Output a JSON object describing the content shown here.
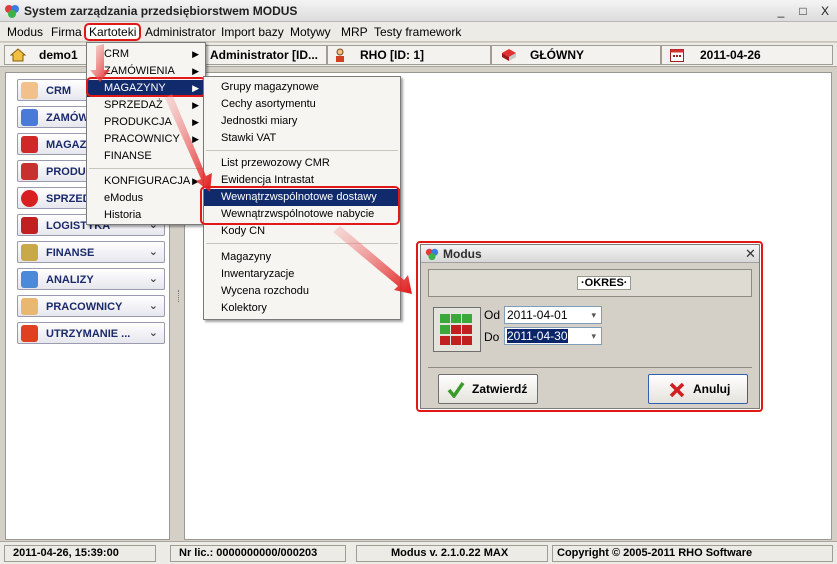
{
  "window": {
    "title": "System zarządzania przedsiębiorstwem MODUS",
    "buttons": [
      "_",
      "□",
      "X"
    ]
  },
  "menubar": [
    "Modus",
    "Firma",
    "Kartoteki",
    "Administrator",
    "Import bazy",
    "Motywy",
    "MRP",
    "Testy framework"
  ],
  "toolbar": {
    "company": "demo1",
    "user": "Administrator [ID...",
    "rho": "RHO [ID: 1]",
    "warehouse": "GŁÓWNY",
    "date": "2011-04-26"
  },
  "sidebar": [
    {
      "label": "CRM",
      "icon": "person-icon"
    },
    {
      "label": "ZAMÓWIENIA",
      "icon": "order-icon"
    },
    {
      "label": "MAGAZYNY",
      "icon": "warehouse-icon"
    },
    {
      "label": "PRODUKCJA",
      "icon": "production-icon"
    },
    {
      "label": "SPRZEDAŻ",
      "icon": "sales-icon"
    },
    {
      "label": "LOGISTYKA",
      "icon": "logistics-icon"
    },
    {
      "label": "FINANSE",
      "icon": "finance-icon"
    },
    {
      "label": "ANALIZY",
      "icon": "analysis-icon"
    },
    {
      "label": "PRACOWNICY",
      "icon": "employees-icon"
    },
    {
      "label": "UTRZYMANIE ...",
      "icon": "maintenance-icon"
    }
  ],
  "kartoteki_menu": [
    "CRM",
    "ZAMÓWIENIA",
    "MAGAZYNY",
    "SPRZEDAŻ",
    "PRODUKCJA",
    "PRACOWNICY",
    "FINANSE",
    "KONFIGURACJA",
    "eModus",
    "Historia"
  ],
  "magazyny_menu": [
    "Grupy magazynowe",
    "Cechy asortymentu",
    "Jednostki miary",
    "Stawki VAT",
    "List przewozowy CMR",
    "Ewidencja Intrastat",
    "Wewnątrzwspólnotowe dostawy",
    "Wewnątrzwspólnotowe nabycie",
    "Kody CN",
    "Magazyny",
    "Inwentaryzacje",
    "Wycena rozchodu",
    "Kolektory"
  ],
  "dialog": {
    "title": "Modus",
    "header": "·OKRES·",
    "from_label": "Od",
    "from_value": "2011-04-01",
    "to_label": "Do",
    "to_value": "2011-04-30",
    "confirm": "Zatwierdź",
    "cancel": "Anuluj"
  },
  "statusbar": {
    "datetime": "2011-04-26,  15:39:00",
    "license": "Nr lic.: 0000000000/000203",
    "version": "Modus v. 2.1.0.22 MAX",
    "copyright": "Copyright © 2005-2011 RHO Software"
  },
  "colors": {
    "highlight": "#102a6c",
    "annotation": "#e01818"
  }
}
